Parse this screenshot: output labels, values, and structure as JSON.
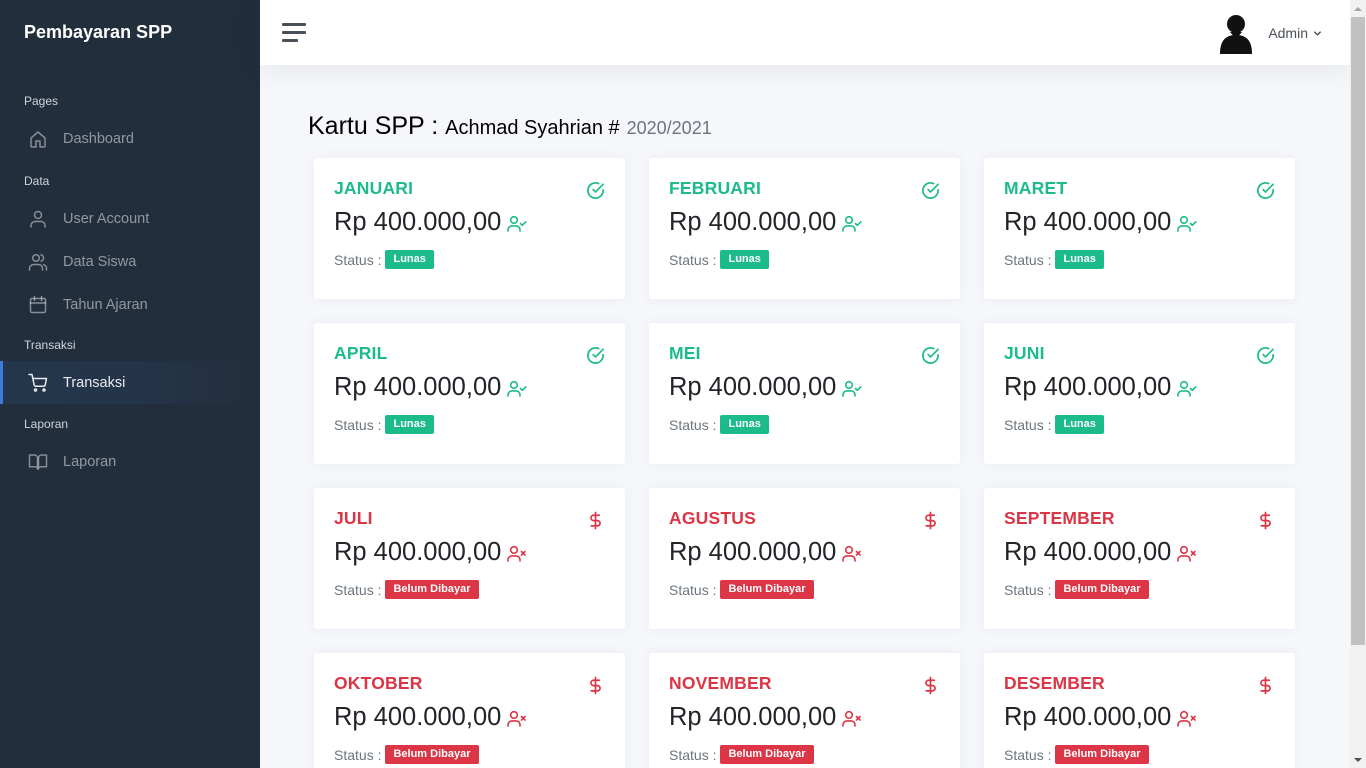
{
  "brand": "Pembayaran SPP",
  "sidebar": {
    "sections": [
      {
        "header": "Pages",
        "items": [
          {
            "label": "Dashboard",
            "icon": "home-icon",
            "active": false
          }
        ]
      },
      {
        "header": "Data",
        "items": [
          {
            "label": "User Account",
            "icon": "user-icon",
            "active": false
          },
          {
            "label": "Data Siswa",
            "icon": "users-icon",
            "active": false
          },
          {
            "label": "Tahun Ajaran",
            "icon": "calendar-icon",
            "active": false
          }
        ]
      },
      {
        "header": "Transaksi",
        "items": [
          {
            "label": "Transaksi",
            "icon": "shopping-cart-icon",
            "active": true
          }
        ]
      },
      {
        "header": "Laporan",
        "items": [
          {
            "label": "Laporan",
            "icon": "book-open-icon",
            "active": false
          }
        ]
      }
    ]
  },
  "topbar": {
    "user_name": "Admin"
  },
  "page": {
    "title": "Kartu SPP :",
    "student": "Achmad Syahrian #",
    "year": "2020/2021"
  },
  "status_label": "Status :",
  "colors": {
    "paid": "#1cbb8c",
    "unpaid": "#dc3545",
    "sidebar": "#222e3c",
    "accent": "#3b7ddd"
  },
  "cards": [
    {
      "month": "JANUARI",
      "amount": "Rp 400.000,00",
      "status": "Lunas",
      "paid": true
    },
    {
      "month": "FEBRUARI",
      "amount": "Rp 400.000,00",
      "status": "Lunas",
      "paid": true
    },
    {
      "month": "MARET",
      "amount": "Rp 400.000,00",
      "status": "Lunas",
      "paid": true
    },
    {
      "month": "APRIL",
      "amount": "Rp 400.000,00",
      "status": "Lunas",
      "paid": true
    },
    {
      "month": "MEI",
      "amount": "Rp 400.000,00",
      "status": "Lunas",
      "paid": true
    },
    {
      "month": "JUNI",
      "amount": "Rp 400.000,00",
      "status": "Lunas",
      "paid": true
    },
    {
      "month": "JULI",
      "amount": "Rp 400.000,00",
      "status": "Belum Dibayar",
      "paid": false
    },
    {
      "month": "AGUSTUS",
      "amount": "Rp 400.000,00",
      "status": "Belum Dibayar",
      "paid": false
    },
    {
      "month": "SEPTEMBER",
      "amount": "Rp 400.000,00",
      "status": "Belum Dibayar",
      "paid": false
    },
    {
      "month": "OKTOBER",
      "amount": "Rp 400.000,00",
      "status": "Belum Dibayar",
      "paid": false
    },
    {
      "month": "NOVEMBER",
      "amount": "Rp 400.000,00",
      "status": "Belum Dibayar",
      "paid": false
    },
    {
      "month": "DESEMBER",
      "amount": "Rp 400.000,00",
      "status": "Belum Dibayar",
      "paid": false
    }
  ]
}
